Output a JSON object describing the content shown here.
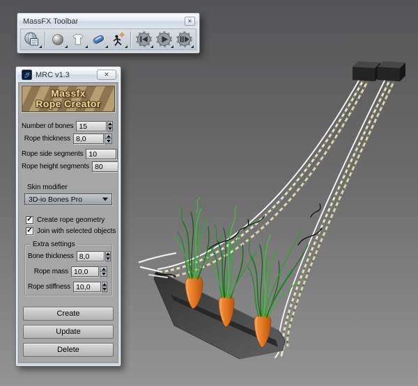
{
  "window_toolbar": {
    "title": "MassFX Toolbar",
    "icons": [
      {
        "name": "massfx-tools"
      },
      {
        "name": "rigid-body"
      },
      {
        "name": "mcloth"
      },
      {
        "name": "constraint"
      },
      {
        "name": "ragdoll"
      },
      {
        "name": "reset-simulation"
      },
      {
        "name": "play-simulation"
      },
      {
        "name": "step-simulation"
      }
    ]
  },
  "window_dialog": {
    "title": "MRC v1.3",
    "banner": {
      "line1": "Massfx",
      "line2": "Rope Creator"
    },
    "fields": [
      {
        "label": "Number of bones",
        "value": "15"
      },
      {
        "label": "Rope thickness",
        "value": "8,0"
      },
      {
        "label": "Rope side segments",
        "value": "10"
      },
      {
        "label": "Rope height segments",
        "value": "80"
      }
    ],
    "skin_modifier": {
      "label": "Skin modifier",
      "selected": "3D-io Bones Pro"
    },
    "checkboxes": [
      {
        "label": "Create rope geometry",
        "checked": true
      },
      {
        "label": "Join with selected objects",
        "checked": true
      }
    ],
    "extra_settings": {
      "title": "Extra settings",
      "fields": [
        {
          "label": "Bone thickness",
          "value": "8,0"
        },
        {
          "label": "Rope mass",
          "value": "10,0"
        },
        {
          "label": "Rope stiffness",
          "value": "10,0"
        }
      ]
    },
    "buttons": [
      {
        "label": "Create"
      },
      {
        "label": "Update"
      },
      {
        "label": "Delete"
      }
    ]
  },
  "glyphs": {
    "close": "✕",
    "check": "✓"
  },
  "scene": {
    "objects": [
      "anchor box",
      "anchor box",
      "rope",
      "rope",
      "ground slab",
      "carrot with greens",
      "carrot with greens",
      "carrot with greens"
    ],
    "colors": {
      "viewport_top": "#555557",
      "viewport_bottom": "#949494",
      "carrot": "#e0762a",
      "greens": "#2f9e2f",
      "rope": "#e6e6cf",
      "slab": "#3f3f3f",
      "banner_gold": "#f0d29a"
    }
  }
}
